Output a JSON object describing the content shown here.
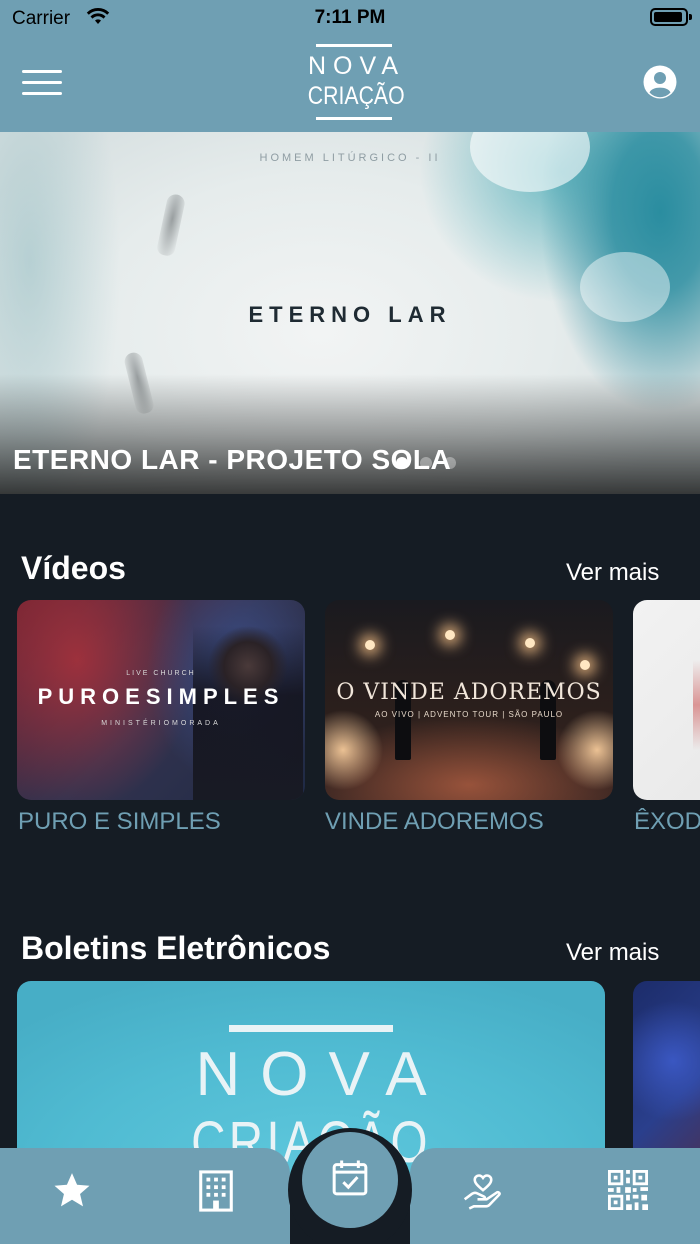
{
  "status_bar": {
    "carrier": "Carrier",
    "time": "7:11 PM"
  },
  "header": {
    "logo_line1": "NOVA",
    "logo_line2": "CRIAÇÃO",
    "menu_icon": "hamburger-menu-icon",
    "profile_icon": "user-circle-icon"
  },
  "hero": {
    "image_top_text": "HOMEM LITÚRGICO - II",
    "image_title": "ETERNO LAR",
    "caption": "ETERNO LAR - PROJETO SOLA",
    "pagination": {
      "count": 3,
      "active": 1
    }
  },
  "videos": {
    "title": "Vídeos",
    "see_more": "Ver mais",
    "items": [
      {
        "label": "PURO E SIMPLES",
        "thumb_small_top": "LIVE CHURCH",
        "thumb_title": "PUROESIMPLES",
        "thumb_small_bottom": "MINISTÉRIOMORADA"
      },
      {
        "label": "VINDE ADOREMOS",
        "thumb_title": "O VINDE ADOREMOS",
        "thumb_subtitle": "AO VIVO | ADVENTO TOUR | SÃO PAULO"
      },
      {
        "label": "ÊXODO"
      }
    ]
  },
  "bulletins": {
    "title": "Boletins Eletrônicos",
    "see_more": "Ver mais",
    "items": [
      {
        "logo_line1": "NOVA",
        "logo_line2": "CRIAÇÃO"
      },
      {}
    ]
  },
  "tab_bar": {
    "items": [
      {
        "icon": "star-icon"
      },
      {
        "icon": "building-icon"
      },
      {
        "icon": "calendar-check-icon",
        "highlighted": true
      },
      {
        "icon": "heart-hand-icon"
      },
      {
        "icon": "qr-code-icon"
      }
    ]
  },
  "colors": {
    "primary": "#6f9fb3",
    "background": "#151c24",
    "video_label": "#6f9fb3",
    "text": "#ffffff"
  }
}
